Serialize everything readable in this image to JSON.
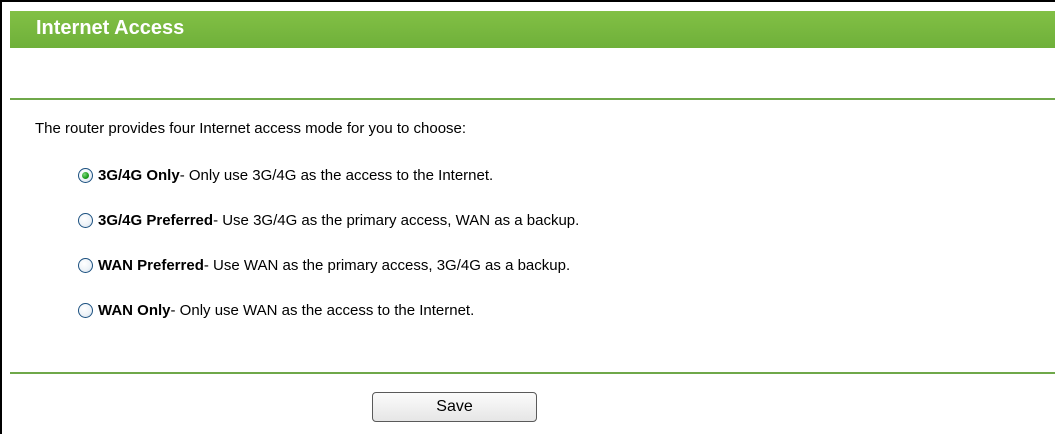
{
  "header": {
    "title": "Internet Access",
    "color": "#7cb342"
  },
  "intro_text": "The router provides four Internet access mode for you to choose:",
  "options": [
    {
      "name": "3G/4G Only",
      "description": " - Only use 3G/4G as the access to the Internet.",
      "selected": true
    },
    {
      "name": "3G/4G Preferred",
      "description": " - Use 3G/4G as the primary access, WAN as a backup.",
      "selected": false
    },
    {
      "name": "WAN Preferred",
      "description": " - Use WAN as the primary access, 3G/4G as a backup.",
      "selected": false
    },
    {
      "name": "WAN Only",
      "description": " - Only use WAN as the access to the Internet.",
      "selected": false
    }
  ],
  "save_label": "Save"
}
